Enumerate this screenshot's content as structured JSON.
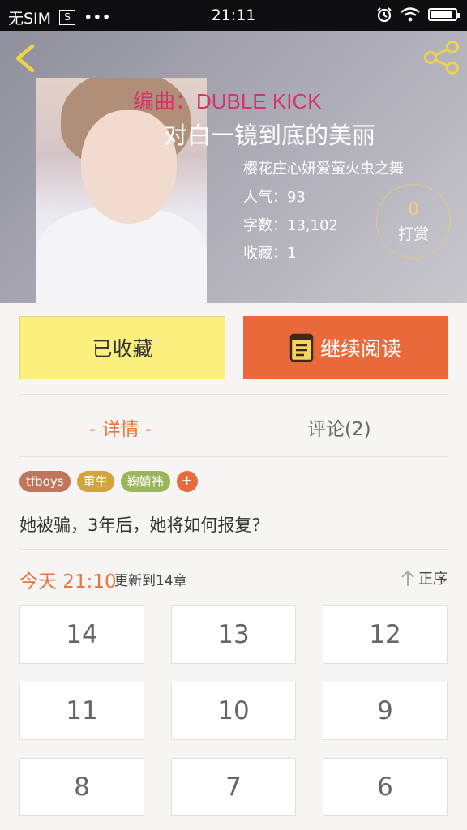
{
  "status_bar": {
    "carrier": "无SIM",
    "sim_icon_glyph": "S",
    "dots": "•••",
    "time": "21:11",
    "icons": [
      "alarm-icon",
      "wifi-icon",
      "battery-icon"
    ]
  },
  "header": {
    "back_icon": "chevron-left-icon",
    "share_icon": "share-icon",
    "composer": "编曲：DUBLE KICK",
    "title": "对白一镜到底的美丽",
    "author": "樱花庄心妍爱萤火虫之舞",
    "popularity": "人气：93",
    "word_count": "字数：13,102",
    "favorites": "收藏：1",
    "tip": {
      "count": "0",
      "label": "打赏"
    }
  },
  "actions": {
    "favorited_label": "已收藏",
    "continue_label": "继续阅读",
    "continue_icon": "book-icon"
  },
  "tabs": {
    "detail": "- 详情 -",
    "comment": "评论(2)"
  },
  "tags": [
    {
      "label": "tfboys",
      "color": "#c0765c"
    },
    {
      "label": "重生",
      "color": "#d4a33e"
    },
    {
      "label": "鞠婧祎",
      "color": "#9bb55a"
    }
  ],
  "tag_add": "+",
  "synopsis": "她被骗，3年后，她将如何报复？",
  "update": {
    "day_time": "今天 21:10",
    "text": "更新到14章",
    "sort_label": "正序",
    "sort_icon": "arrow-up-icon"
  },
  "chapters": [
    "14",
    "13",
    "12",
    "11",
    "10",
    "9",
    "8",
    "7",
    "6"
  ],
  "colors": {
    "accent": "#e9693b",
    "favorite_bg": "#fbf07e",
    "composer_text": "#d6336c"
  }
}
